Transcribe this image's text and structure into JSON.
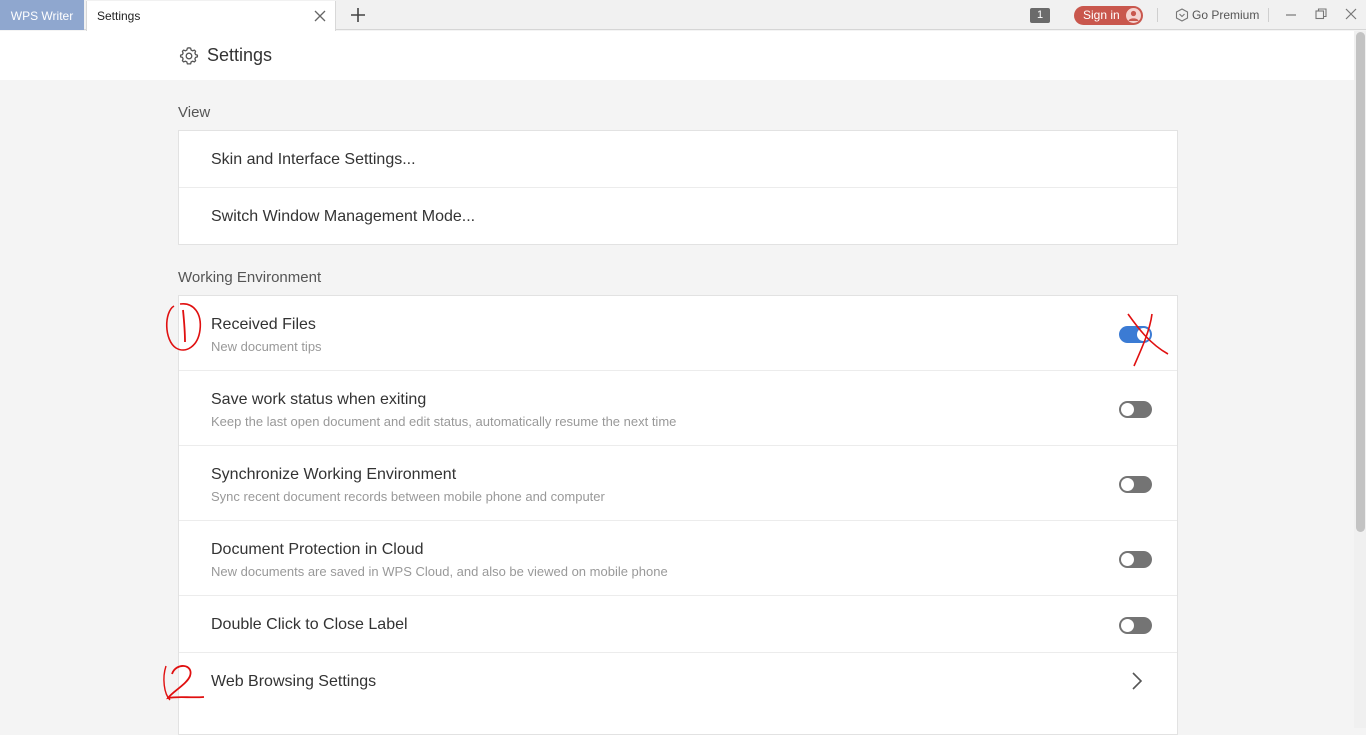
{
  "titlebar": {
    "app_tab": "WPS Writer",
    "doc_tab": "Settings",
    "window_count": "1",
    "sign_in": "Sign in",
    "premium": "Go Premium"
  },
  "header": {
    "title": "Settings"
  },
  "view": {
    "heading": "View",
    "items": [
      {
        "label": "Skin and Interface Settings..."
      },
      {
        "label": "Switch Window Management Mode..."
      }
    ]
  },
  "working": {
    "heading": "Working Environment",
    "items": [
      {
        "label": "Received Files",
        "sub": "New document tips",
        "toggle": true
      },
      {
        "label": "Save work status when exiting",
        "sub": "Keep the last open document and edit status, automatically resume the next time",
        "toggle": false
      },
      {
        "label": "Synchronize Working Environment",
        "sub": "Sync recent document records between mobile phone and computer",
        "toggle": false
      },
      {
        "label": "Document Protection in Cloud",
        "sub": "New documents are saved in WPS Cloud, and also be viewed on mobile phone",
        "toggle": false
      },
      {
        "label": "Double Click to Close Label",
        "toggle": false
      },
      {
        "label": "Web Browsing Settings"
      }
    ]
  },
  "annotations": {
    "mark1": "1",
    "mark2": "2",
    "color": "#e01010"
  },
  "colors": {
    "accent": "#3b7bd4",
    "toggle_off": "#747474",
    "signin": "#c9574d"
  },
  "icons": [
    "close-icon",
    "plus-icon",
    "user-icon",
    "premium-icon",
    "minimize-icon",
    "restore-icon",
    "window-close-icon",
    "gear-icon",
    "chevron-right-icon"
  ]
}
